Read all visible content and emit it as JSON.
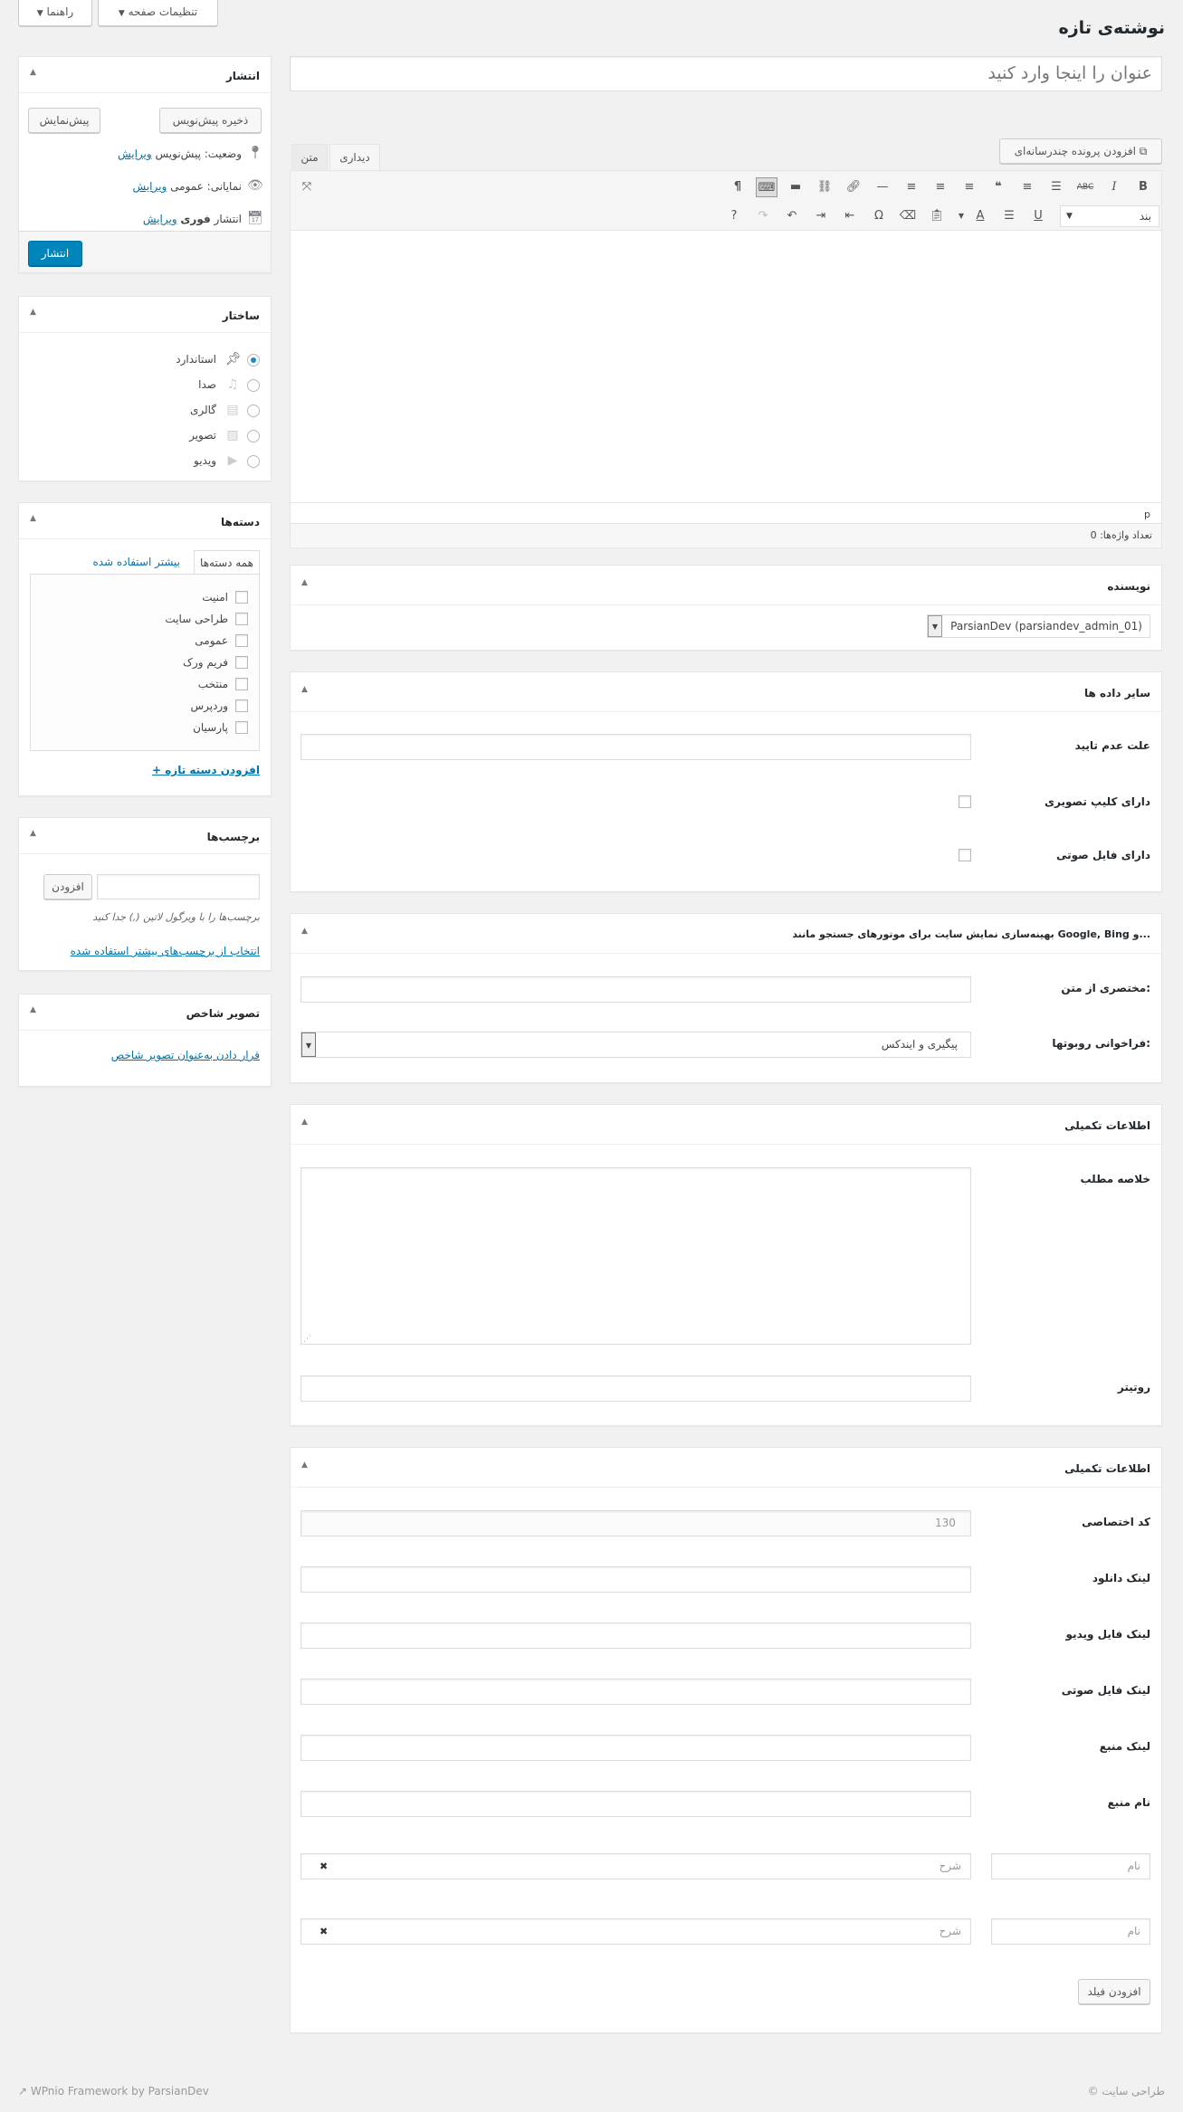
{
  "screen_meta": {
    "options_label": "تنظیمات صفحه",
    "help_label": "راهنما"
  },
  "page_title": "نوشته‌ی تازه",
  "title_placeholder": "عنوان را اینجا وارد کنید",
  "editor": {
    "add_media": "افزودن پرونده چندرسانه‌ای",
    "tab_visual": "دیداری",
    "tab_text": "متن",
    "format_select": "بند",
    "path": "p",
    "word_count": "تعداد واژه‌ها: 0"
  },
  "publish": {
    "title": "انتشار",
    "save_draft": "ذخیره پیش‌نویس",
    "preview": "پیش‌نمایش",
    "status_label": "وضعیت:",
    "status_value": "پیش‌نویس",
    "visibility_label": "نمایانی:",
    "visibility_value": "عمومی",
    "publish_label": "انتشار",
    "publish_value": "فوری",
    "edit": "ویرایش",
    "publish_button": "انتشار"
  },
  "format": {
    "title": "ساختار",
    "items": [
      {
        "label": "استاندارد",
        "icon": "pin-icon",
        "checked": true
      },
      {
        "label": "صدا",
        "icon": "audio-icon",
        "checked": false
      },
      {
        "label": "گالری",
        "icon": "gallery-icon",
        "checked": false
      },
      {
        "label": "تصویر",
        "icon": "image-icon",
        "checked": false
      },
      {
        "label": "ویدیو",
        "icon": "video-icon",
        "checked": false
      }
    ]
  },
  "categories": {
    "title": "دسته‌ها",
    "tab_all": "همه دسته‌ها",
    "tab_popular": "بیشتر استفاده شده",
    "items": [
      "امنیت",
      "طراحی سایت",
      "عمومی",
      "فریم ورک",
      "منتخب",
      "وردپرس",
      "پارسیان"
    ],
    "add_new": "+ افزودن دسته تازه"
  },
  "tags": {
    "title": "برچسب‌ها",
    "add_button": "افزودن",
    "hint": "برچسب‌ها را با ویرگول لاتین (,) جدا کنید",
    "choose_link": "انتخاب از برچسب‌های بیشتر استفاده شده"
  },
  "featured_image": {
    "title": "تصویر شاخص",
    "link": "قرار دادن به‌عنوان تصویر شاخص"
  },
  "author": {
    "title": "نویسنده",
    "selected": "ParsianDev (parsiandev_admin_01)"
  },
  "other_data": {
    "title": "سایر داده ها",
    "reject_reason": "علت عدم تایید",
    "has_video": "دارای کلیپ تصویری",
    "has_audio": "دارای فایل صوتی"
  },
  "seo": {
    "title": "بهینه‌سازی نمایش سایت برای موتورهای جستجو مانند Google, Bing و...",
    "excerpt_label": "مختصری از متن:",
    "robots_label": "فراخوانی روبوتها:",
    "robots_value": "پیگیری و ایندکس"
  },
  "extra1": {
    "title": "اطلاعات تکمیلی",
    "summary_label": "خلاصه مطلب",
    "rotitr_label": "روتیتر"
  },
  "extra2": {
    "title": "اطلاعات تکمیلی",
    "code_label": "کد اختصاصی",
    "code_value": "130",
    "download_label": "لینک دانلود",
    "video_label": "لینک فایل ویدیو",
    "audio_label": "لینک فایل صوتی",
    "source_link_label": "لینک منبع",
    "source_name_label": "نام منبع",
    "repeat_rows": [
      {
        "name_placeholder": "نام",
        "desc_placeholder": "شرح",
        "remove": "✖"
      },
      {
        "name_placeholder": "نام",
        "desc_placeholder": "شرح",
        "remove": "✖"
      }
    ],
    "add_field": "افزودن فیلد"
  },
  "footer": {
    "left": "WPnio Framework by ParsianDev",
    "right": "© طراحی سایت"
  }
}
